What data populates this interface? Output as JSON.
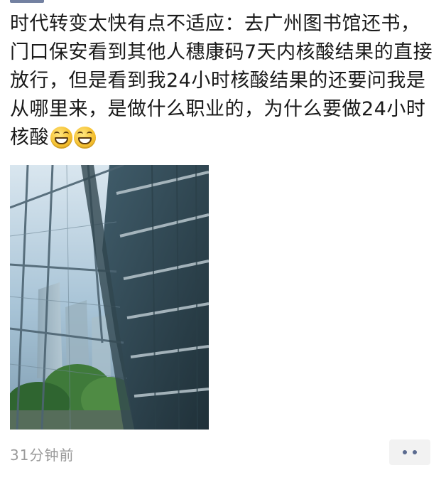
{
  "post": {
    "text": "时代转变太快有点不适应：去广州图书馆还书，门口保安看到其他人穗康码7天内核酸结果的直接放行，但是看到我24小时核酸结果的还要问我是从哪里来，是做什么职业的，为什么要做24小时核酸",
    "emojis": [
      "grin-emoji",
      "grin-emoji"
    ],
    "photo": {
      "subject": "glass-building-atrium"
    },
    "timestamp": "31分钟前"
  },
  "actions": {
    "more_icon": "ellipsis-icon"
  },
  "colors": {
    "text": "#1a1a1a",
    "timestamp": "#9a9a9a",
    "link_blue": "#5b6b90",
    "more_bg": "#f2f2f2"
  }
}
